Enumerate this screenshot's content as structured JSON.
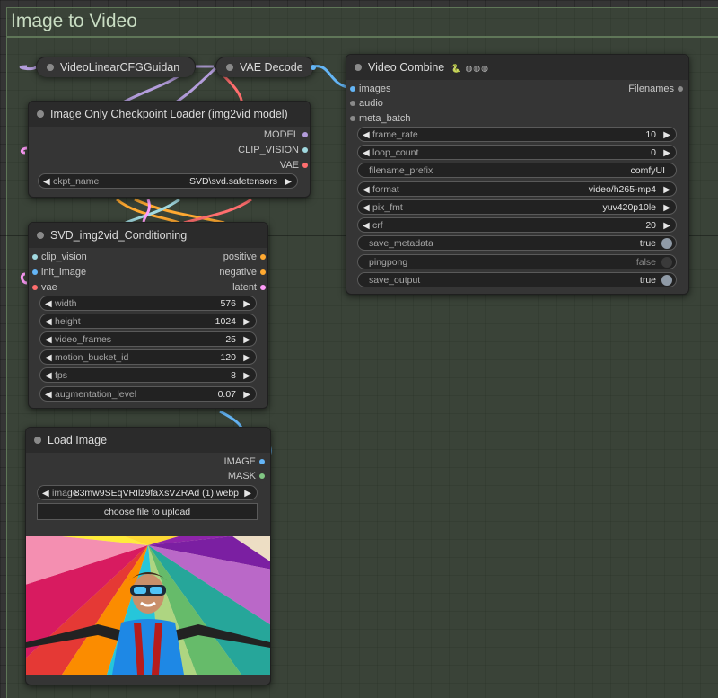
{
  "group": {
    "title": "Image to Video"
  },
  "colors": {
    "model": "#b39ddb",
    "clip_vision": "#a1d9e0",
    "vae": "#ff6e6e",
    "image": "#64b5f6",
    "mask": "#81c784",
    "latent": "#ff9cf9",
    "conditioning": "#ffa931"
  },
  "nodes": {
    "cfg_guidance": {
      "title": "VideoLinearCFGGuidan"
    },
    "vae_decode": {
      "title": "VAE Decode"
    },
    "checkpoint_loader": {
      "title": "Image Only Checkpoint Loader (img2vid model)",
      "outputs": [
        "MODEL",
        "CLIP_VISION",
        "VAE"
      ],
      "ckpt_name": {
        "label": "ckpt_name",
        "value": "SVD\\svd.safetensors"
      }
    },
    "conditioning": {
      "title": "SVD_img2vid_Conditioning",
      "inputs": [
        "clip_vision",
        "init_image",
        "vae"
      ],
      "outputs": [
        "positive",
        "negative",
        "latent"
      ],
      "widgets": [
        {
          "label": "width",
          "value": "576"
        },
        {
          "label": "height",
          "value": "1024"
        },
        {
          "label": "video_frames",
          "value": "25"
        },
        {
          "label": "motion_bucket_id",
          "value": "120"
        },
        {
          "label": "fps",
          "value": "8"
        },
        {
          "label": "augmentation_level",
          "value": "0.07"
        }
      ]
    },
    "load_image": {
      "title": "Load Image",
      "outputs": [
        "IMAGE",
        "MASK"
      ],
      "image_label": "image",
      "image_value": "T83mw9SEqVRIlz9faXsVZRAd (1).webp",
      "upload_button": "choose file to upload"
    },
    "video_combine": {
      "title": "Video Combine",
      "badge": "🐍 ◍◍◍",
      "inputs": [
        "images",
        "audio",
        "meta_batch"
      ],
      "outputs": [
        "Filenames"
      ],
      "widgets": [
        {
          "label": "frame_rate",
          "value": "10"
        },
        {
          "label": "loop_count",
          "value": "0"
        },
        {
          "label": "filename_prefix",
          "value": "comfyUI"
        },
        {
          "label": "format",
          "value": "video/h265-mp4"
        },
        {
          "label": "pix_fmt",
          "value": "yuv420p10le"
        },
        {
          "label": "crf",
          "value": "20"
        },
        {
          "label": "save_metadata",
          "value": "true"
        },
        {
          "label": "pingpong",
          "value": "false"
        },
        {
          "label": "save_output",
          "value": "true"
        }
      ]
    }
  }
}
